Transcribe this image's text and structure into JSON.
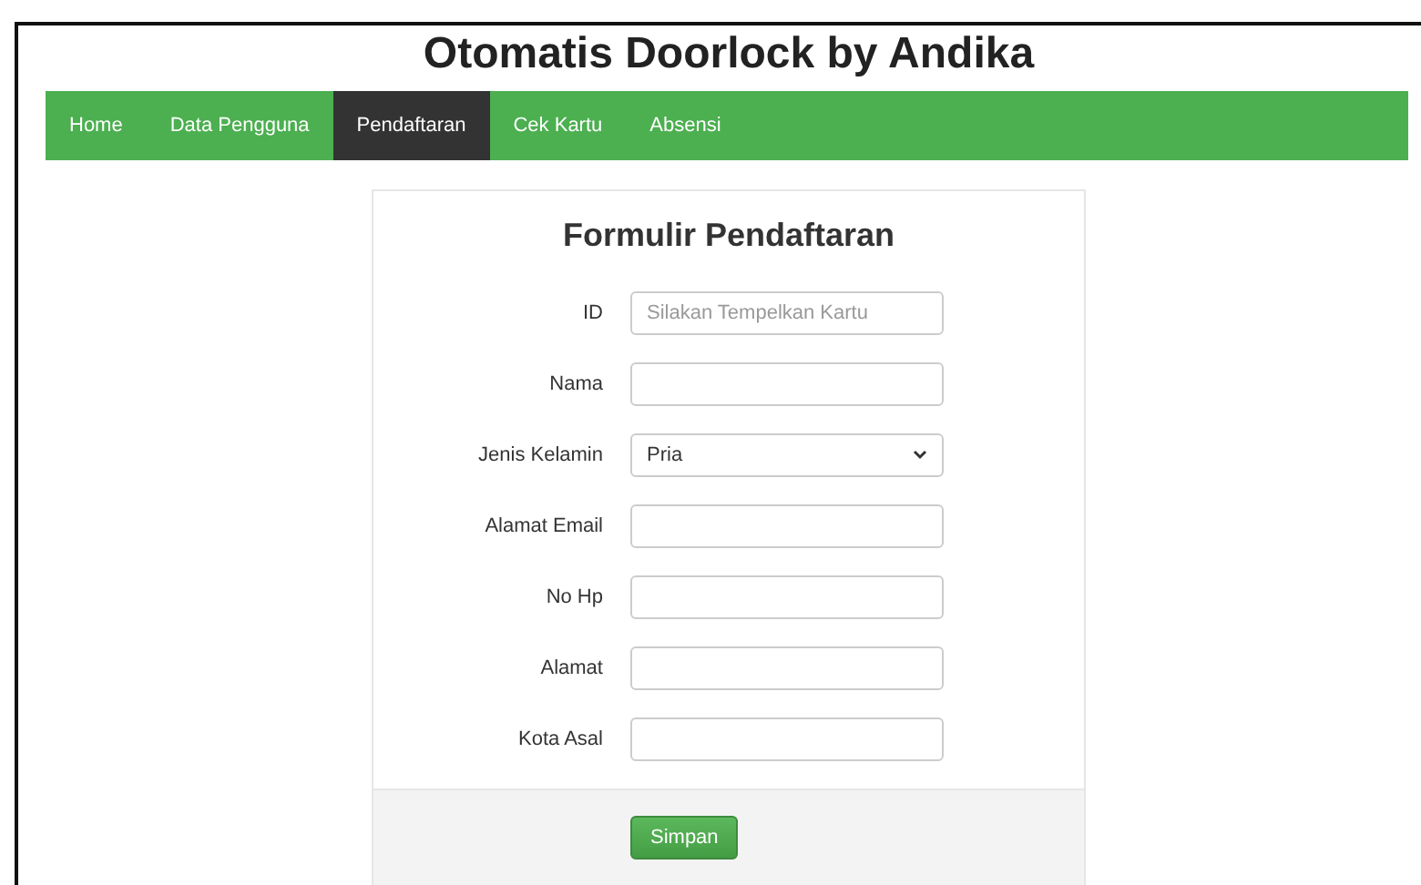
{
  "page_title": "Otomatis Doorlock by Andika",
  "nav": [
    {
      "label": "Home",
      "selected": false
    },
    {
      "label": "Data Pengguna",
      "selected": false
    },
    {
      "label": "Pendaftaran",
      "selected": true
    },
    {
      "label": "Cek Kartu",
      "selected": false
    },
    {
      "label": "Absensi",
      "selected": false
    }
  ],
  "form": {
    "title": "Formulir Pendaftaran",
    "fields": [
      {
        "label": "ID",
        "kind": "text",
        "placeholder": "Silakan Tempelkan Kartu"
      },
      {
        "label": "Nama",
        "kind": "text"
      },
      {
        "label": "Jenis Kelamin",
        "kind": "select",
        "value": "Pria"
      },
      {
        "label": "Alamat Email",
        "kind": "text"
      },
      {
        "label": "No Hp",
        "kind": "text"
      },
      {
        "label": "Alamat",
        "kind": "text"
      },
      {
        "label": "Kota Asal",
        "kind": "text"
      }
    ],
    "submit": "Simpan"
  }
}
